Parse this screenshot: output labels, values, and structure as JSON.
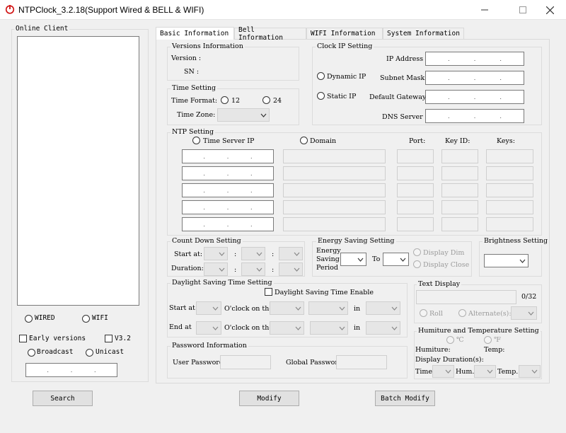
{
  "window": {
    "title": "NTPClock_3.2.18(Support Wired & BELL & WIFI)"
  },
  "left": {
    "online_client_label": "Online Client",
    "wired_label": "WIRED",
    "wifi_label": "WIFI",
    "early_versions_label": "Early versions",
    "v32_label": "V3.2",
    "broadcast_label": "Broadcast",
    "unicast_label": "Unicast",
    "ip_dots": ". . ."
  },
  "buttons": {
    "search": "Search",
    "modify": "Modify",
    "batch_modify": "Batch Modify"
  },
  "tabs": [
    {
      "label": "Basic  Information"
    },
    {
      "label": "Bell  Information"
    },
    {
      "label": "WIFI  Information"
    },
    {
      "label": "System  Information"
    }
  ],
  "versions": {
    "title": "Versions Information",
    "version_label": "Version :",
    "sn_label": "SN :"
  },
  "time_setting": {
    "title": "Time Setting",
    "format_label": "Time Format:",
    "opt12": "12",
    "opt24": "24",
    "zone_label": "Time Zone:"
  },
  "clock_ip": {
    "title": "Clock IP Setting",
    "dynamic_ip": "Dynamic IP",
    "static_ip": "Static IP",
    "ip_address": "IP Address :",
    "subnet": "Subnet Mask :",
    "gateway": "Default Gateway :",
    "dns": "DNS Server  :"
  },
  "ntp": {
    "title": "NTP Setting",
    "time_server_ip": "Time Server IP",
    "domain": "Domain",
    "port": "Port:",
    "key_id": "Key ID:",
    "keys": "Keys:"
  },
  "countdown": {
    "title": "Count Down Setting",
    "start_at": "Start at:",
    "duration": "Duration:",
    "sep": ":"
  },
  "energy": {
    "title": "Energy Saving Setting",
    "label_l1": "Energy",
    "label_l2": "Saving :",
    "label_l3": "Period",
    "to": "To",
    "display_dim": "Display Dim",
    "display_close": "Display Close"
  },
  "brightness": {
    "title": "Brightness Setting"
  },
  "dst": {
    "title": "Daylight Saving Time Setting",
    "enable": "Daylight Saving Time Enable",
    "start_at": "Start at",
    "end_at": "End at",
    "oclock_on_the": "O'clock on the",
    "in": "in"
  },
  "text_display": {
    "title": "Text Display",
    "counter": "0/32",
    "roll": "Roll",
    "alternate": "Alternate(s):"
  },
  "humiture": {
    "title": "Humiture and Temperature Setting",
    "celsius": "℃",
    "fahrenheit": "℉",
    "humiture": "Humiture:",
    "temp": "Temp:",
    "display_duration": "Display Duration(s):",
    "time": "Time:",
    "hum": "Hum.:",
    "temp2": "Temp.:"
  },
  "password": {
    "title": "Password Information",
    "user": "User Password:",
    "global": "Global Password:"
  }
}
